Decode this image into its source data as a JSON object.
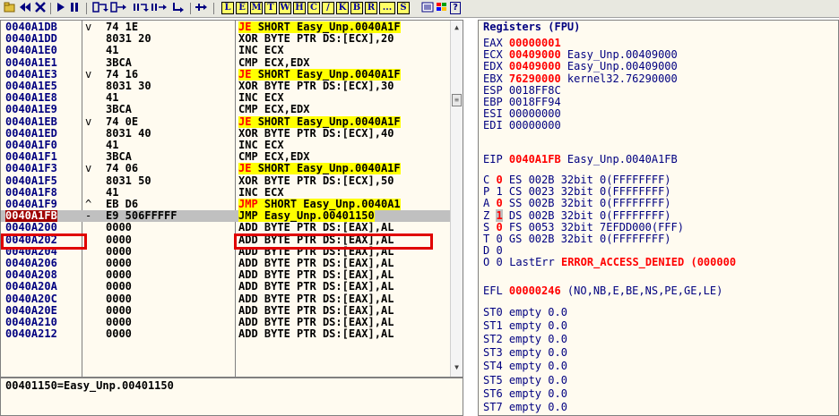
{
  "toolbar": {
    "buttons": [
      "open-icon",
      "rewind-icon",
      "close-icon",
      "run-icon",
      "pause-icon",
      "step-into-icon",
      "step-over-icon",
      "trace-into-icon",
      "trace-over-icon",
      "execute-till-return-icon",
      "go-to-icon"
    ],
    "letters": [
      "L",
      "E",
      "M",
      "T",
      "W",
      "H",
      "C",
      "/",
      "K",
      "B",
      "R",
      "...",
      "S"
    ],
    "extra": [
      "list-icon",
      "windows-icon",
      "help-icon"
    ],
    "help_label": "?"
  },
  "disasm": {
    "rows": [
      {
        "addr": "0040A1DB",
        "arrow": "v",
        "hex": "74 1E",
        "mnemonic": "JE",
        "operand": "SHORT Easy_Unp.0040A1F",
        "highlight": "jump"
      },
      {
        "addr": "0040A1DD",
        "arrow": "",
        "hex": "8031 20",
        "mnemonic": "XOR",
        "operand": "BYTE PTR DS:[ECX],20",
        "highlight": ""
      },
      {
        "addr": "0040A1E0",
        "arrow": "",
        "hex": "41",
        "mnemonic": "INC",
        "operand": "ECX",
        "highlight": ""
      },
      {
        "addr": "0040A1E1",
        "arrow": "",
        "hex": "3BCA",
        "mnemonic": "CMP",
        "operand": "ECX,EDX",
        "highlight": ""
      },
      {
        "addr": "0040A1E3",
        "arrow": "v",
        "hex": "74 16",
        "mnemonic": "JE",
        "operand": "SHORT Easy_Unp.0040A1F",
        "highlight": "jump"
      },
      {
        "addr": "0040A1E5",
        "arrow": "",
        "hex": "8031 30",
        "mnemonic": "XOR",
        "operand": "BYTE PTR DS:[ECX],30",
        "highlight": ""
      },
      {
        "addr": "0040A1E8",
        "arrow": "",
        "hex": "41",
        "mnemonic": "INC",
        "operand": "ECX",
        "highlight": ""
      },
      {
        "addr": "0040A1E9",
        "arrow": "",
        "hex": "3BCA",
        "mnemonic": "CMP",
        "operand": "ECX,EDX",
        "highlight": ""
      },
      {
        "addr": "0040A1EB",
        "arrow": "v",
        "hex": "74 0E",
        "mnemonic": "JE",
        "operand": "SHORT Easy_Unp.0040A1F",
        "highlight": "jump"
      },
      {
        "addr": "0040A1ED",
        "arrow": "",
        "hex": "8031 40",
        "mnemonic": "XOR",
        "operand": "BYTE PTR DS:[ECX],40",
        "highlight": ""
      },
      {
        "addr": "0040A1F0",
        "arrow": "",
        "hex": "41",
        "mnemonic": "INC",
        "operand": "ECX",
        "highlight": ""
      },
      {
        "addr": "0040A1F1",
        "arrow": "",
        "hex": "3BCA",
        "mnemonic": "CMP",
        "operand": "ECX,EDX",
        "highlight": ""
      },
      {
        "addr": "0040A1F3",
        "arrow": "v",
        "hex": "74 06",
        "mnemonic": "JE",
        "operand": "SHORT Easy_Unp.0040A1F",
        "highlight": "jump"
      },
      {
        "addr": "0040A1F5",
        "arrow": "",
        "hex": "8031 50",
        "mnemonic": "XOR",
        "operand": "BYTE PTR DS:[ECX],50",
        "highlight": ""
      },
      {
        "addr": "0040A1F8",
        "arrow": "",
        "hex": "41",
        "mnemonic": "INC",
        "operand": "ECX",
        "highlight": ""
      },
      {
        "addr": "0040A1F9",
        "arrow": "^",
        "hex": "EB D6",
        "mnemonic": "JMP",
        "operand": "SHORT Easy_Unp.0040A1",
        "highlight": "jump"
      },
      {
        "addr": "0040A1FB",
        "arrow": "-",
        "hex": "E9 506FFFFF",
        "mnemonic": "JMP",
        "operand": "Easy_Unp.00401150",
        "highlight": "current"
      },
      {
        "addr": "0040A200",
        "arrow": "",
        "hex": "0000",
        "mnemonic": "ADD",
        "operand": "BYTE PTR DS:[EAX],AL",
        "highlight": ""
      },
      {
        "addr": "0040A202",
        "arrow": "",
        "hex": "0000",
        "mnemonic": "ADD",
        "operand": "BYTE PTR DS:[EAX],AL",
        "highlight": ""
      },
      {
        "addr": "0040A204",
        "arrow": "",
        "hex": "0000",
        "mnemonic": "ADD",
        "operand": "BYTE PTR DS:[EAX],AL",
        "highlight": ""
      },
      {
        "addr": "0040A206",
        "arrow": "",
        "hex": "0000",
        "mnemonic": "ADD",
        "operand": "BYTE PTR DS:[EAX],AL",
        "highlight": ""
      },
      {
        "addr": "0040A208",
        "arrow": "",
        "hex": "0000",
        "mnemonic": "ADD",
        "operand": "BYTE PTR DS:[EAX],AL",
        "highlight": ""
      },
      {
        "addr": "0040A20A",
        "arrow": "",
        "hex": "0000",
        "mnemonic": "ADD",
        "operand": "BYTE PTR DS:[EAX],AL",
        "highlight": ""
      },
      {
        "addr": "0040A20C",
        "arrow": "",
        "hex": "0000",
        "mnemonic": "ADD",
        "operand": "BYTE PTR DS:[EAX],AL",
        "highlight": ""
      },
      {
        "addr": "0040A20E",
        "arrow": "",
        "hex": "0000",
        "mnemonic": "ADD",
        "operand": "BYTE PTR DS:[EAX],AL",
        "highlight": ""
      },
      {
        "addr": "0040A210",
        "arrow": "",
        "hex": "0000",
        "mnemonic": "ADD",
        "operand": "BYTE PTR DS:[EAX],AL",
        "highlight": ""
      },
      {
        "addr": "0040A212",
        "arrow": "",
        "hex": "0000",
        "mnemonic": "ADD",
        "operand": "BYTE PTR DS:[EAX],AL",
        "highlight": ""
      }
    ]
  },
  "info_line": "00401150=Easy_Unp.00401150",
  "registers": {
    "title": "Registers (FPU)",
    "gp": [
      {
        "name": "EAX",
        "value": "00000001",
        "symbol": "",
        "changed": true
      },
      {
        "name": "ECX",
        "value": "00409000",
        "symbol": "Easy_Unp.00409000",
        "changed": true
      },
      {
        "name": "EDX",
        "value": "00409000",
        "symbol": "Easy_Unp.00409000",
        "changed": true
      },
      {
        "name": "EBX",
        "value": "76290000",
        "symbol": "kernel32.76290000",
        "changed": true
      },
      {
        "name": "ESP",
        "value": "0018FF8C",
        "symbol": "",
        "changed": false
      },
      {
        "name": "EBP",
        "value": "0018FF94",
        "symbol": "",
        "changed": false
      },
      {
        "name": "ESI",
        "value": "00000000",
        "symbol": "",
        "changed": false
      },
      {
        "name": "EDI",
        "value": "00000000",
        "symbol": "",
        "changed": false
      }
    ],
    "eip": {
      "name": "EIP",
      "value": "0040A1FB",
      "symbol": "Easy_Unp.0040A1FB"
    },
    "flags": [
      {
        "flag": "C",
        "val": "0",
        "changed": true,
        "seg": "ES",
        "sel": "002B",
        "bits": "32bit",
        "base": "0(FFFFFFFF)"
      },
      {
        "flag": "P",
        "val": "1",
        "changed": false,
        "seg": "CS",
        "sel": "0023",
        "bits": "32bit",
        "base": "0(FFFFFFFF)"
      },
      {
        "flag": "A",
        "val": "0",
        "changed": true,
        "seg": "SS",
        "sel": "002B",
        "bits": "32bit",
        "base": "0(FFFFFFFF)"
      },
      {
        "flag": "Z",
        "val": "1",
        "changed": true,
        "seg": "DS",
        "sel": "002B",
        "bits": "32bit",
        "base": "0(FFFFFFFF)"
      },
      {
        "flag": "S",
        "val": "0",
        "changed": true,
        "seg": "FS",
        "sel": "0053",
        "bits": "32bit",
        "base": "7EFDD000(FFF)"
      },
      {
        "flag": "T",
        "val": "0",
        "changed": false,
        "seg": "GS",
        "sel": "002B",
        "bits": "32bit",
        "base": "0(FFFFFFFF)"
      },
      {
        "flag": "D",
        "val": "0",
        "changed": false,
        "seg": "",
        "sel": "",
        "bits": "",
        "base": ""
      },
      {
        "flag": "O",
        "val": "0",
        "changed": false,
        "seg": "",
        "sel": "",
        "bits": "",
        "base": ""
      }
    ],
    "lasterr_label": "LastErr",
    "lasterr_value": "ERROR_ACCESS_DENIED (000000",
    "efl_label": "EFL",
    "efl_value": "00000246",
    "efl_desc": "(NO,NB,E,BE,NS,PE,GE,LE)",
    "fpu": [
      {
        "name": "ST0",
        "value": "empty 0.0"
      },
      {
        "name": "ST1",
        "value": "empty 0.0"
      },
      {
        "name": "ST2",
        "value": "empty 0.0"
      },
      {
        "name": "ST3",
        "value": "empty 0.0"
      },
      {
        "name": "ST4",
        "value": "empty 0.0"
      },
      {
        "name": "ST5",
        "value": "empty 0.0"
      },
      {
        "name": "ST6",
        "value": "empty 0.0"
      },
      {
        "name": "ST7",
        "value": "empty 0.0"
      }
    ]
  },
  "colors": {
    "highlight": "#ffff00",
    "current_bg": "#a00000",
    "changed": "#ff0000",
    "accent_box": "#e00000"
  }
}
